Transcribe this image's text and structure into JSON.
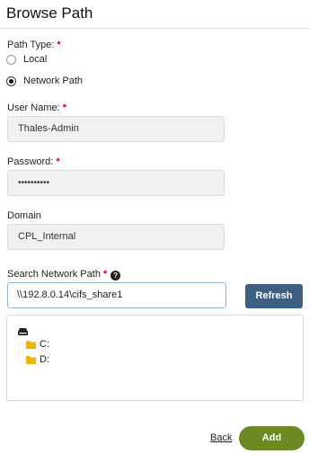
{
  "dialog": {
    "title": "Browse Path"
  },
  "path_type": {
    "label": "Path Type:",
    "required_mark": "*",
    "options": [
      {
        "label": "Local",
        "selected": false
      },
      {
        "label": "Network Path",
        "selected": true
      }
    ]
  },
  "user_name": {
    "label": "User Name:",
    "required_mark": "*",
    "value": "Thales-Admin"
  },
  "password": {
    "label": "Password:",
    "required_mark": "*",
    "value": "••••••••••"
  },
  "domain": {
    "label": "Domain",
    "value": "CPL_Internal"
  },
  "search": {
    "label": "Search Network Path",
    "required_mark": "*",
    "help_icon": "?",
    "value": "\\\\192.8.0.14\\cifs_share1",
    "refresh_label": "Refresh"
  },
  "tree": {
    "root_icon": "drive-icon",
    "items": [
      {
        "label": "C:",
        "icon": "folder-icon"
      },
      {
        "label": "D:",
        "icon": "folder-icon"
      }
    ]
  },
  "footer": {
    "back_label": "Back",
    "add_label": "Add"
  },
  "colors": {
    "required": "#d0021b",
    "refresh_bg": "#3d5f82",
    "add_bg": "#6b8a23",
    "folder": "#f0b400"
  }
}
